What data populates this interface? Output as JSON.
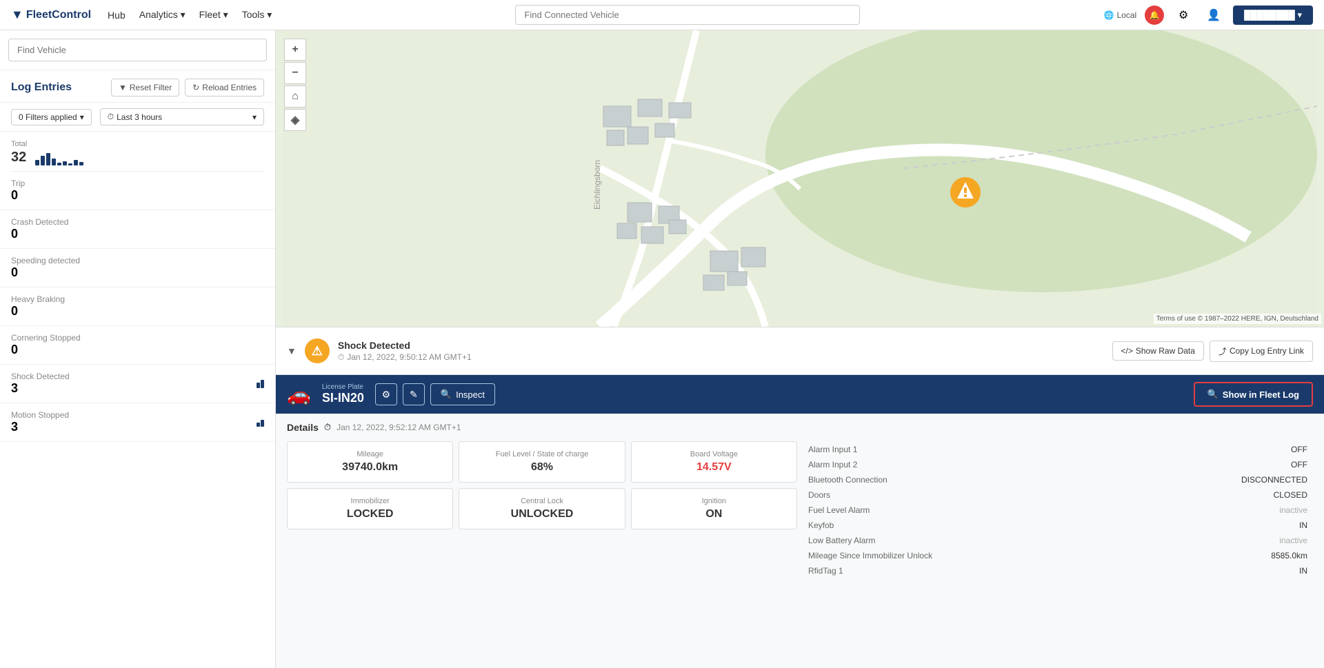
{
  "brand": {
    "icon": "▼",
    "name": "FleetControl"
  },
  "nav": {
    "links": [
      "Hub",
      "Analytics",
      "Fleet",
      "Tools"
    ],
    "search_placeholder": "Find Connected Vehicle",
    "locale": "Local",
    "icons": [
      "🌐",
      "🔔",
      "⚙",
      "👤"
    ],
    "user_btn": "▼"
  },
  "sidebar": {
    "search_placeholder": "Find Vehicle",
    "title": "Log Entries",
    "reset_btn": "Reset Filter",
    "reload_btn": "Reload Entries",
    "filters": {
      "applied": "0 Filters applied",
      "time": "Last 3 hours"
    },
    "stats": {
      "total_label": "Total",
      "total_value": "32",
      "items": [
        {
          "label": "Trip",
          "value": "0",
          "bars": []
        },
        {
          "label": "Crash Detected",
          "value": "0",
          "bars": []
        },
        {
          "label": "Speeding detected",
          "value": "0",
          "bars": []
        },
        {
          "label": "Heavy Braking",
          "value": "0",
          "bars": []
        },
        {
          "label": "Cornering Stopped",
          "value": "0",
          "bars": []
        },
        {
          "label": "Shock Detected",
          "value": "3",
          "bars": [
            8,
            12
          ]
        },
        {
          "label": "Motion Stopped",
          "value": "3",
          "bars": [
            6,
            10
          ]
        }
      ]
    }
  },
  "event": {
    "title": "Shock Detected",
    "time": "Jan 12, 2022, 9:50:12 AM GMT+1",
    "raw_data_btn": "</> Show Raw Data",
    "copy_link_btn": "Copy Log Entry Link"
  },
  "vehicle": {
    "plate_label": "License Plate",
    "plate": "SI-IN20",
    "fleet_log_btn": "Show in Fleet Log",
    "inspect_btn": "Inspect"
  },
  "details": {
    "title": "Details",
    "time": "Jan 12, 2022, 9:52:12 AM GMT+1",
    "cards": [
      {
        "label": "Mileage",
        "value": "39740.0km",
        "color": "normal"
      },
      {
        "label": "Fuel Level / State of charge",
        "value": "68%",
        "color": "normal"
      },
      {
        "label": "Board Voltage",
        "value": "14.57V",
        "color": "red"
      },
      {
        "label": "Immobilizer",
        "value": "LOCKED",
        "color": "normal"
      },
      {
        "label": "Central Lock",
        "value": "UNLOCKED",
        "color": "normal"
      },
      {
        "label": "Ignition",
        "value": "ON",
        "color": "normal"
      }
    ],
    "info": [
      {
        "label": "Alarm Input 1",
        "value": "OFF",
        "inactive": false
      },
      {
        "label": "Alarm Input 2",
        "value": "OFF",
        "inactive": false
      },
      {
        "label": "Bluetooth Connection",
        "value": "DISCONNECTED",
        "inactive": false
      },
      {
        "label": "Doors",
        "value": "CLOSED",
        "inactive": false
      },
      {
        "label": "Fuel Level Alarm",
        "value": "inactive",
        "inactive": true
      },
      {
        "label": "Keyfob",
        "value": "IN",
        "inactive": false
      },
      {
        "label": "Low Battery Alarm",
        "value": "inactive",
        "inactive": true
      },
      {
        "label": "Mileage Since Immobilizer Unlock",
        "value": "8585.0km",
        "inactive": false
      },
      {
        "label": "RfidTag 1",
        "value": "IN",
        "inactive": false
      }
    ]
  },
  "map": {
    "watermark": "Terms of use  © 1987–2022 HERE, IGN, Deutschland",
    "label": "Eichlingsborn"
  }
}
